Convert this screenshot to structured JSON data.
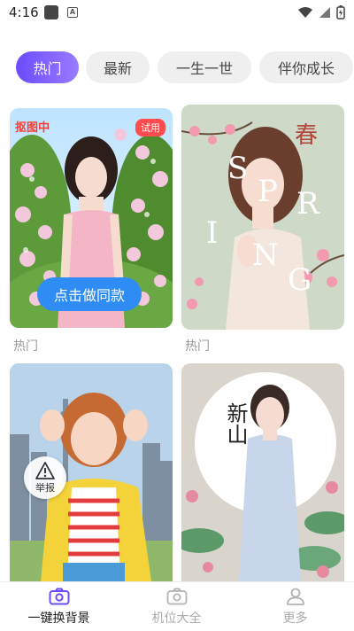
{
  "status_bar": {
    "time": "4:16",
    "icons": [
      "app-icon",
      "a-icon",
      "wifi-icon",
      "signal-icon",
      "battery-icon"
    ]
  },
  "tabs": [
    {
      "label": "热门",
      "active": true
    },
    {
      "label": "最新",
      "active": false
    },
    {
      "label": "一生一世",
      "active": false
    },
    {
      "label": "伴你成长",
      "active": false
    }
  ],
  "cards": [
    {
      "label": "热门",
      "badge_trial": "试用",
      "badge_matting": "抠图中",
      "button": "点击做同款"
    },
    {
      "label": "热门",
      "poster_letters": [
        "S",
        "P",
        "R",
        "I",
        "N",
        "G"
      ],
      "poster_chinese": "春"
    },
    {
      "report_label": "举报"
    },
    {
      "poster_chinese": "新山"
    }
  ],
  "bottom_nav": [
    {
      "label": "一键换背景",
      "icon": "camera-icon",
      "active": true
    },
    {
      "label": "机位大全",
      "icon": "camera-icon",
      "active": false
    },
    {
      "label": "更多",
      "icon": "person-icon",
      "active": false
    }
  ],
  "colors": {
    "accent": "#6b4cff",
    "button_blue": "#2f8cf5",
    "badge_red": "#ff4d4f"
  }
}
